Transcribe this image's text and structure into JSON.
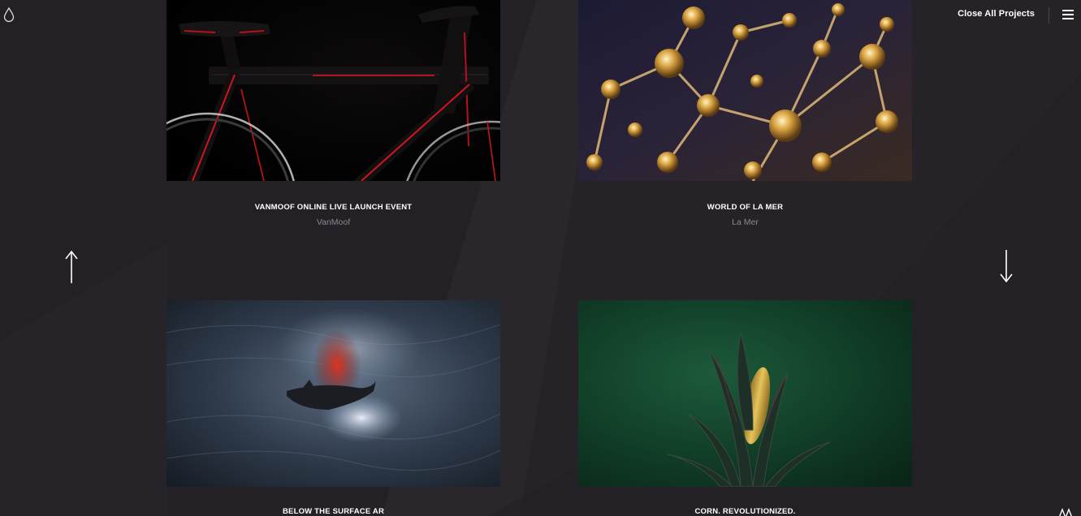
{
  "header": {
    "close_label": "Close All Projects",
    "logo_icon": "droplet-icon",
    "menu_icon": "hamburger-icon"
  },
  "navigation": {
    "up_icon": "arrow-up-icon",
    "down_icon": "arrow-down-icon"
  },
  "projects": [
    {
      "title": "VANMOOF ONLINE LIVE LAUNCH EVENT",
      "client": "VanMoof"
    },
    {
      "title": "WORLD OF LA MER",
      "client": "La Mer"
    },
    {
      "title": "BELOW THE SURFACE AR",
      "client": ""
    },
    {
      "title": "CORN. REVOLUTIONIZED.",
      "client": ""
    }
  ],
  "colors": {
    "background": "#232126",
    "text": "#ffffff",
    "muted": "#8b898e"
  }
}
